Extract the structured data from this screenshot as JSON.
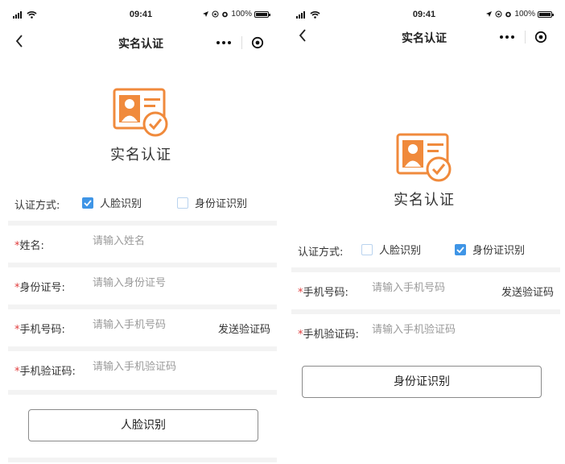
{
  "status_bar": {
    "time": "09:41",
    "battery": "100%"
  },
  "nav": {
    "title": "实名认证"
  },
  "hero": {
    "title": "实名认证"
  },
  "colors": {
    "accent": "#f08a3c",
    "checkbox": "#3f95e6",
    "required": "#e03b3b"
  },
  "left": {
    "method": {
      "label": "认证方式:",
      "options": [
        {
          "label": "人脸识别",
          "checked": true
        },
        {
          "label": "身份证识别",
          "checked": false
        }
      ]
    },
    "fields": [
      {
        "label": "姓名:",
        "placeholder": "请输入姓名"
      },
      {
        "label": "身份证号:",
        "placeholder": "请输入身份证号"
      },
      {
        "label": "手机号码:",
        "placeholder": "请输入手机号码",
        "action": "发送验证码"
      },
      {
        "label": "手机验证码:",
        "placeholder": "请输入手机验证码"
      }
    ],
    "button": "人脸识别"
  },
  "right": {
    "method": {
      "label": "认证方式:",
      "options": [
        {
          "label": "人脸识别",
          "checked": false
        },
        {
          "label": "身份证识别",
          "checked": true
        }
      ]
    },
    "fields": [
      {
        "label": "手机号码:",
        "placeholder": "请输入手机号码",
        "action": "发送验证码"
      },
      {
        "label": "手机验证码:",
        "placeholder": "请输入手机验证码"
      }
    ],
    "button": "身份证识别"
  }
}
